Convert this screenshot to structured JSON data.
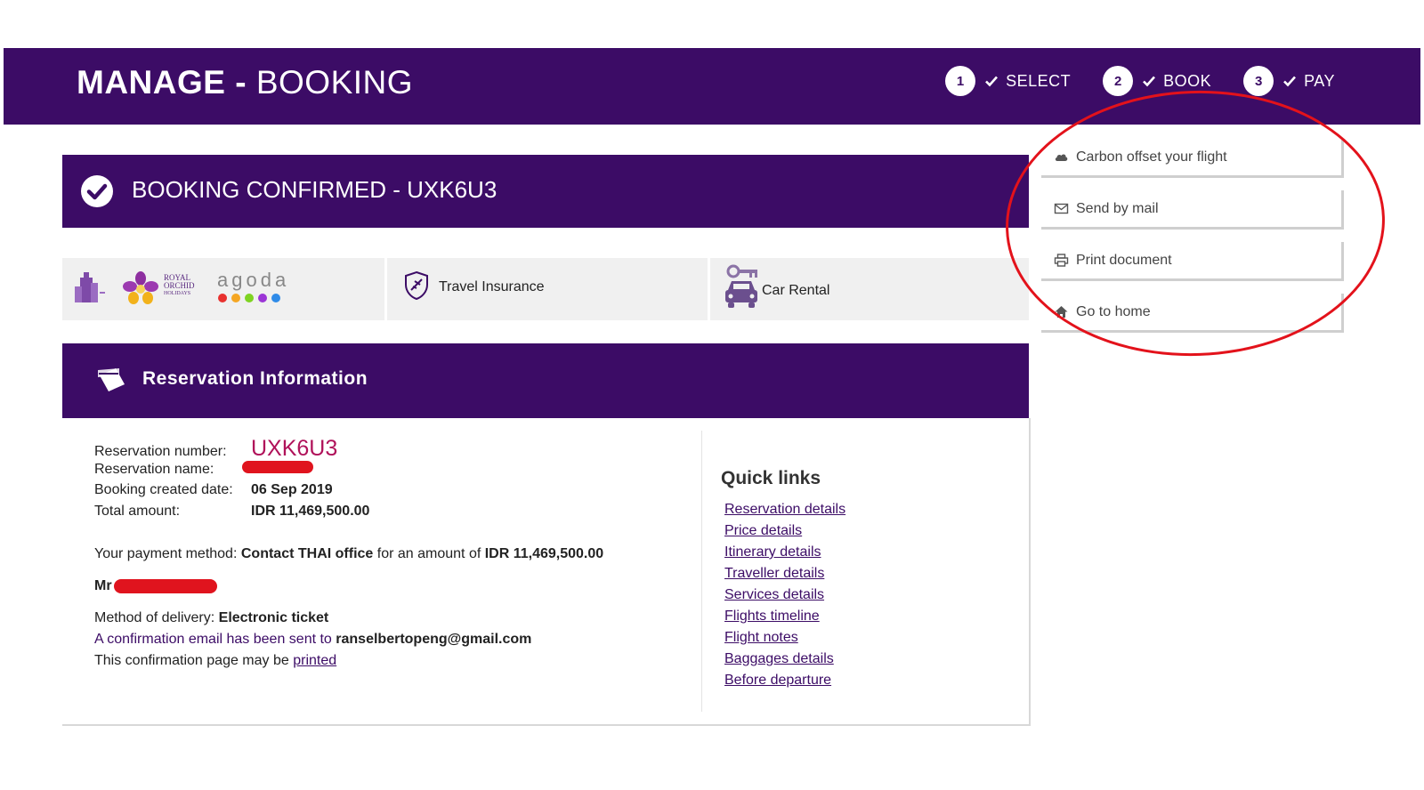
{
  "header": {
    "title_bold": "MANAGE -",
    "title_light": "BOOKING",
    "steps": [
      {
        "num": "1",
        "label": "SELECT"
      },
      {
        "num": "2",
        "label": "BOOK"
      },
      {
        "num": "3",
        "label": "PAY"
      }
    ]
  },
  "confirmation": {
    "text": "BOOKING CONFIRMED - UXK6U3"
  },
  "partners": {
    "hotel_logo_text": [
      "ROYAL",
      "ORCHID",
      "HOLIDAYS",
      "agoda"
    ],
    "travel_insurance": "Travel Insurance",
    "car_rental": "Car Rental"
  },
  "side_menu": {
    "items": [
      {
        "label": "Carbon offset your flight",
        "icon": "cloud-icon"
      },
      {
        "label": "Send by mail",
        "icon": "envelope-icon"
      },
      {
        "label": "Print document",
        "icon": "printer-icon"
      },
      {
        "label": "Go to home",
        "icon": "home-icon"
      }
    ]
  },
  "reservation": {
    "title": "Reservation Information",
    "number_label": "Reservation number:",
    "number_value": "UXK6U3",
    "name_label": "Reservation name:",
    "created_label": "Booking created date:",
    "created_value": "06 Sep 2019",
    "total_label": "Total amount:",
    "total_value": "IDR 11,469,500.00",
    "payment_prefix": "Your payment method:",
    "payment_method": "Contact THAI office",
    "payment_mid": "for an amount of",
    "payment_amount": "IDR 11,469,500.00",
    "passenger_title": "Mr",
    "delivery_label": "Method of delivery:",
    "delivery_value": "Electronic ticket",
    "email_prefix": "A confirmation email has been sent to",
    "email_value": "ranselbertopeng@gmail.com",
    "print_prefix": "This confirmation page may be",
    "print_link": "printed"
  },
  "quick_links": {
    "title": "Quick links",
    "items": [
      "Reservation details",
      "Price details",
      "Itinerary details",
      "Traveller details",
      "Services details",
      "Flights timeline",
      "Flight notes",
      "Baggages details",
      "Before departure"
    ]
  },
  "colors": {
    "brand_purple": "#3c0c66",
    "reservation_number": "#b0125a",
    "annotation_red": "#e3121b",
    "redaction_red": "#e0141e"
  }
}
